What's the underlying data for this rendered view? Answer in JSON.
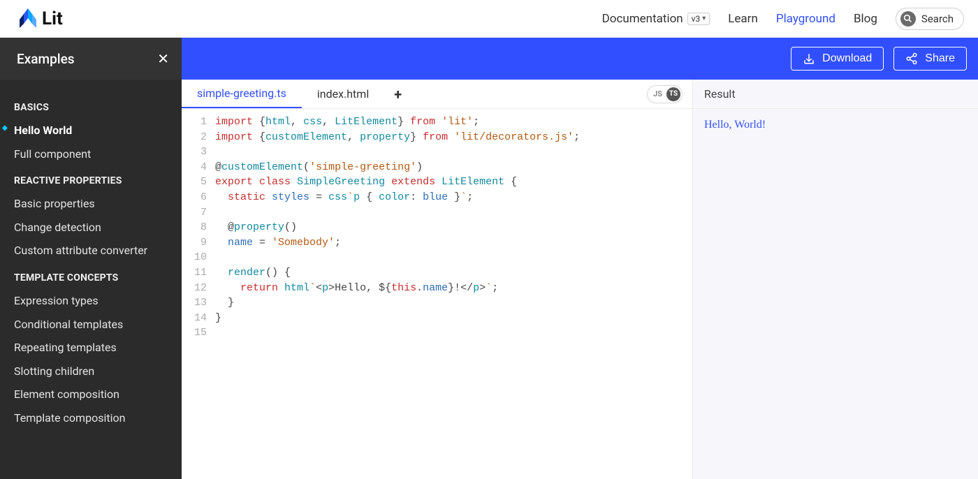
{
  "header": {
    "brand": "Lit",
    "nav": {
      "documentation": "Documentation",
      "version": "v3",
      "learn": "Learn",
      "playground": "Playground",
      "blog": "Blog",
      "search": "Search"
    }
  },
  "sidebar": {
    "title": "Examples",
    "groups": [
      {
        "label": "BASICS",
        "items": [
          "Hello World",
          "Full component"
        ],
        "activeIndex": 0
      },
      {
        "label": "REACTIVE PROPERTIES",
        "items": [
          "Basic properties",
          "Change detection",
          "Custom attribute converter"
        ],
        "activeIndex": -1
      },
      {
        "label": "TEMPLATE CONCEPTS",
        "items": [
          "Expression types",
          "Conditional templates",
          "Repeating templates",
          "Slotting children",
          "Element composition",
          "Template composition"
        ],
        "activeIndex": -1
      }
    ]
  },
  "bluebar": {
    "download": "Download",
    "share": "Share"
  },
  "tabs": {
    "items": [
      "simple-greeting.ts",
      "index.html"
    ],
    "langJS": "JS",
    "langTS": "TS"
  },
  "code": {
    "lines": [
      {
        "n": 1,
        "html": "<span class='kw'>import</span> {<span class='fn'>html</span>, <span class='fn'>css</span>, <span class='cls'>LitElement</span>} <span class='kw'>from</span> <span class='str'>'lit'</span>;"
      },
      {
        "n": 2,
        "html": "<span class='kw'>import</span> {<span class='fn'>customElement</span>, <span class='fn'>property</span>} <span class='kw'>from</span> <span class='str'>'lit/decorators.js'</span>;"
      },
      {
        "n": 3,
        "html": ""
      },
      {
        "n": 4,
        "html": "@<span class='fn'>customElement</span>(<span class='str'>'simple-greeting'</span>)"
      },
      {
        "n": 5,
        "html": "<span class='kw'>export</span> <span class='kw'>class</span> <span class='cls'>SimpleGreeting</span> <span class='kw'>extends</span> <span class='cls'>LitElement</span> {"
      },
      {
        "n": 6,
        "html": "  <span class='kw'>static</span> <span class='fn2'>styles</span> = <span class='fn'>css</span><span class='str'>`</span><span class='htmltag'>p</span> { <span class='attr'>color</span>: <span class='fn2'>blue</span> }<span class='str'>`</span>;"
      },
      {
        "n": 7,
        "html": ""
      },
      {
        "n": 8,
        "html": "  @<span class='fn'>property</span>()"
      },
      {
        "n": 9,
        "html": "  <span class='fn2'>name</span> = <span class='str'>'Somebody'</span>;"
      },
      {
        "n": 10,
        "html": ""
      },
      {
        "n": 11,
        "html": "  <span class='fn'>render</span>() {"
      },
      {
        "n": 12,
        "html": "    <span class='kw'>return</span> <span class='fn'>html</span><span class='str'>`</span>&lt;<span class='htmltag'>p</span>&gt;Hello, ${<span class='kw'>this</span>.<span class='fn2'>name</span>}!&lt;/<span class='htmltag'>p</span>&gt;<span class='str'>`</span>;"
      },
      {
        "n": 13,
        "html": "  }"
      },
      {
        "n": 14,
        "html": "}"
      },
      {
        "n": 15,
        "html": ""
      }
    ]
  },
  "result": {
    "label": "Result",
    "output": "Hello, World!"
  }
}
